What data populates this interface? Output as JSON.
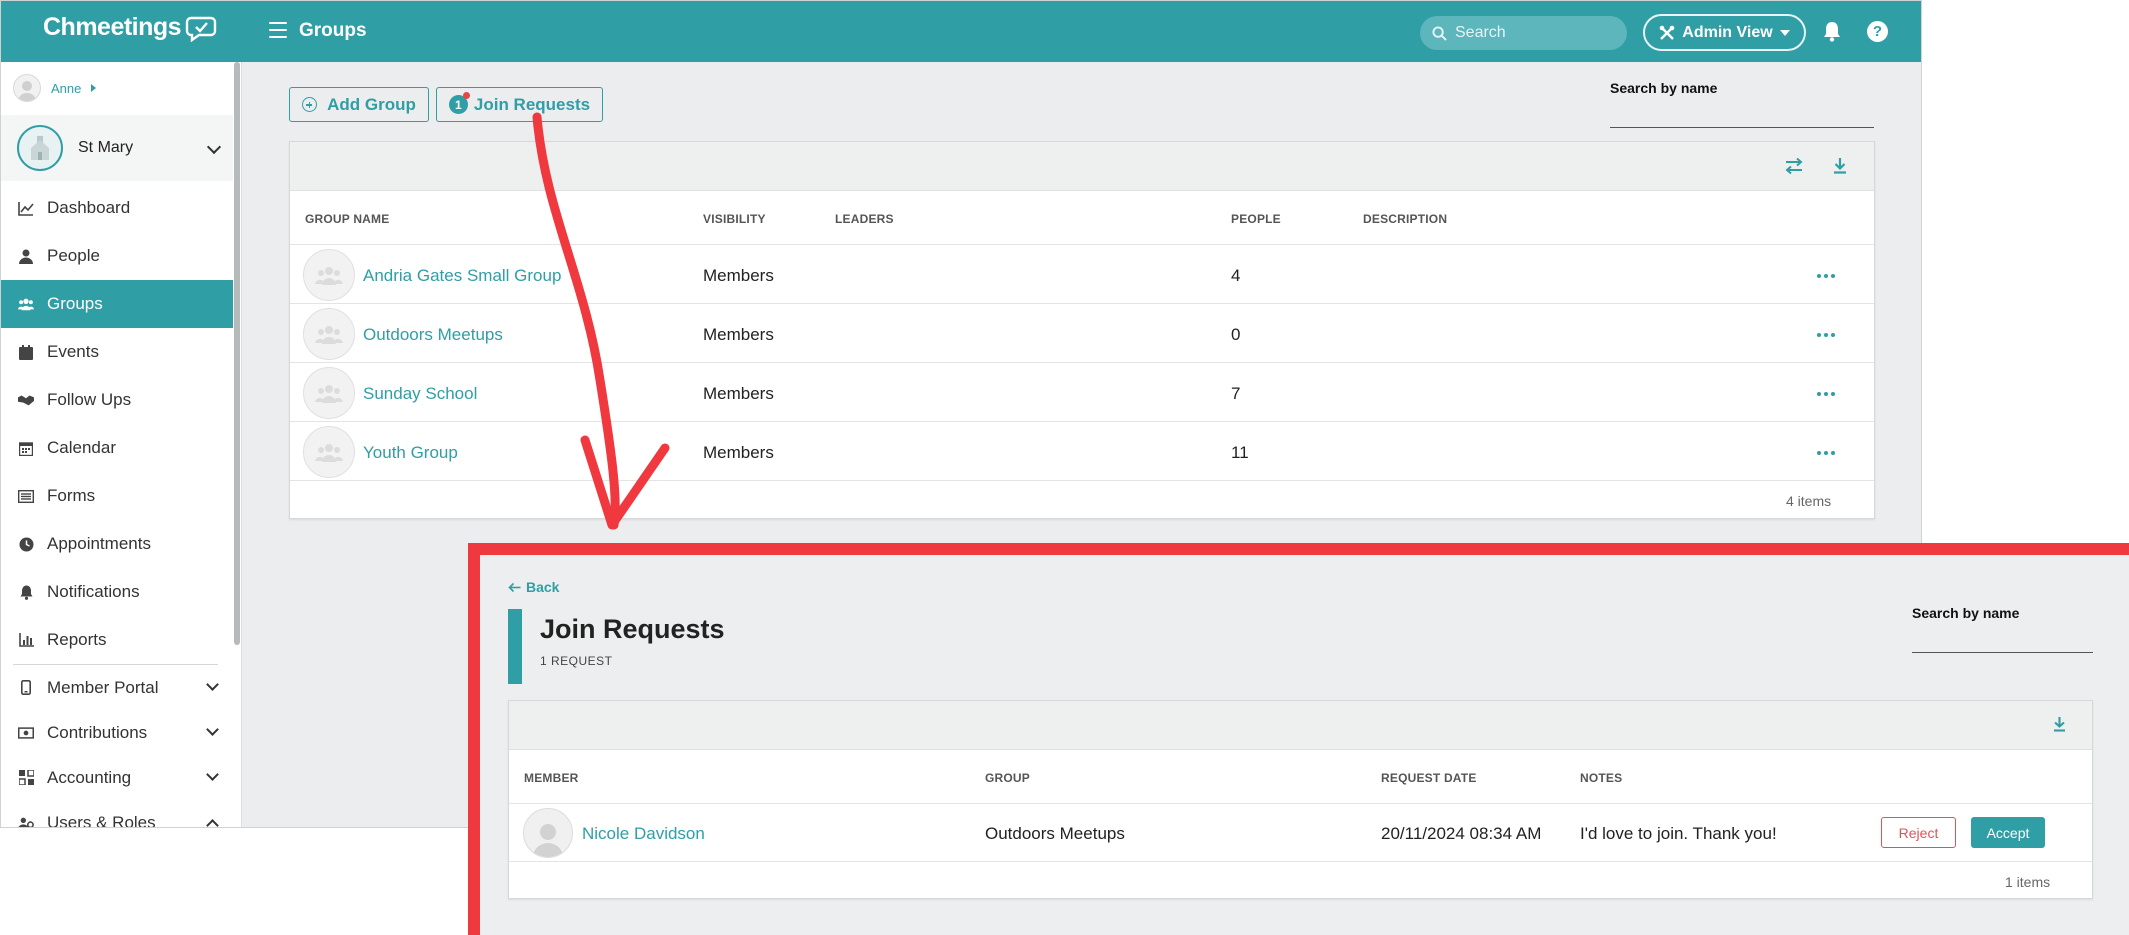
{
  "app": {
    "logo_text": "Chmeetings",
    "page_title": "Groups",
    "search_placeholder": "Search",
    "admin_view_label": "Admin View"
  },
  "sidebar": {
    "user_name": "Anne",
    "church_name": "St Mary",
    "items": [
      {
        "label": "Dashboard",
        "icon": "chart-line-icon"
      },
      {
        "label": "People",
        "icon": "person-icon"
      },
      {
        "label": "Groups",
        "icon": "people-group-icon",
        "active": true
      },
      {
        "label": "Events",
        "icon": "calendar-event-icon"
      },
      {
        "label": "Follow Ups",
        "icon": "handshake-icon"
      },
      {
        "label": "Calendar",
        "icon": "calendar-grid-icon"
      },
      {
        "label": "Forms",
        "icon": "form-list-icon"
      },
      {
        "label": "Appointments",
        "icon": "clock-icon"
      },
      {
        "label": "Notifications",
        "icon": "bell-icon"
      },
      {
        "label": "Reports",
        "icon": "bar-chart-icon"
      }
    ],
    "groups": [
      {
        "label": "Member Portal",
        "icon": "mobile-icon",
        "expanded": false
      },
      {
        "label": "Contributions",
        "icon": "money-icon",
        "expanded": false
      },
      {
        "label": "Accounting",
        "icon": "grid-apps-icon",
        "expanded": false
      },
      {
        "label": "Users & Roles",
        "icon": "users-cog-icon",
        "expanded": true
      }
    ]
  },
  "groups_page": {
    "add_group_label": "Add Group",
    "join_requests_label": "Join Requests",
    "join_requests_count": "1",
    "search_by_name_label": "Search by name",
    "columns": {
      "name": "GROUP NAME",
      "visibility": "VISIBILITY",
      "leaders": "LEADERS",
      "people": "PEOPLE",
      "description": "DESCRIPTION"
    },
    "rows": [
      {
        "name": "Andria Gates Small Group",
        "visibility": "Members",
        "leaders": "",
        "people": "4",
        "description": ""
      },
      {
        "name": "Outdoors Meetups",
        "visibility": "Members",
        "leaders": "",
        "people": "0",
        "description": ""
      },
      {
        "name": "Sunday School",
        "visibility": "Members",
        "leaders": "",
        "people": "7",
        "description": ""
      },
      {
        "name": "Youth Group",
        "visibility": "Members",
        "leaders": "",
        "people": "11",
        "description": ""
      }
    ],
    "items_count": "4 items"
  },
  "join_requests_page": {
    "back_label": "Back",
    "title": "Join Requests",
    "subtitle": "1  REQUEST",
    "search_by_name_label": "Search by name",
    "columns": {
      "member": "MEMBER",
      "group": "GROUP",
      "request_date": "REQUEST DATE",
      "notes": "NOTES"
    },
    "rows": [
      {
        "member": "Nicole Davidson",
        "group": "Outdoors Meetups",
        "request_date": "20/11/2024 08:34 AM",
        "notes": "I'd love to join. Thank you!"
      }
    ],
    "reject_label": "Reject",
    "accept_label": "Accept",
    "items_count": "1 items"
  },
  "colors": {
    "brand_teal": "#2f9ea5",
    "annotation_red": "#f0383f",
    "reject_red": "#e0525a"
  }
}
